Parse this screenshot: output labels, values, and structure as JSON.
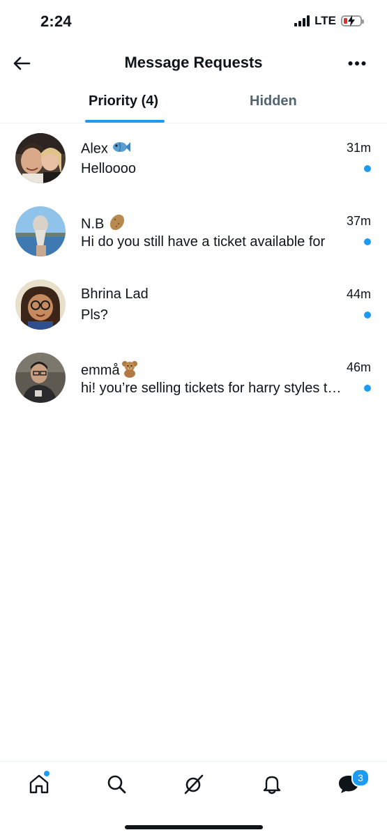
{
  "status_bar": {
    "time": "2:24",
    "network": "LTE"
  },
  "header": {
    "title": "Message Requests",
    "back_icon": "arrow-left-icon",
    "more_icon": "more-horizontal-icon"
  },
  "tabs": [
    {
      "label": "Priority (4)",
      "selected": true
    },
    {
      "label": "Hidden",
      "selected": false
    }
  ],
  "messages": [
    {
      "name": "Alex",
      "emoji": "fish-icon",
      "time": "31m",
      "preview": "Helloooo",
      "unread": true
    },
    {
      "name": "N.B",
      "emoji": "potato-icon",
      "time": "37m",
      "preview": "Hi do you still have a ticket available for",
      "unread": true
    },
    {
      "name": "Bhrina Lad",
      "emoji": "",
      "time": "44m",
      "preview": "Pls?",
      "unread": true
    },
    {
      "name": "emmå",
      "emoji": "teddy-bear-icon",
      "time": "46m",
      "preview": "hi! you’re selling tickets for harry styles tonight?",
      "unread": true
    }
  ],
  "bottom_nav": {
    "items": [
      "home-icon",
      "search-icon",
      "grok-icon",
      "bell-icon",
      "messages-icon"
    ],
    "messages_badge": "3",
    "home_has_dot": true
  },
  "colors": {
    "accent": "#1d9bf0",
    "text": "#0f1419",
    "secondary_text": "#536471",
    "battery_low": "#e0302b"
  }
}
